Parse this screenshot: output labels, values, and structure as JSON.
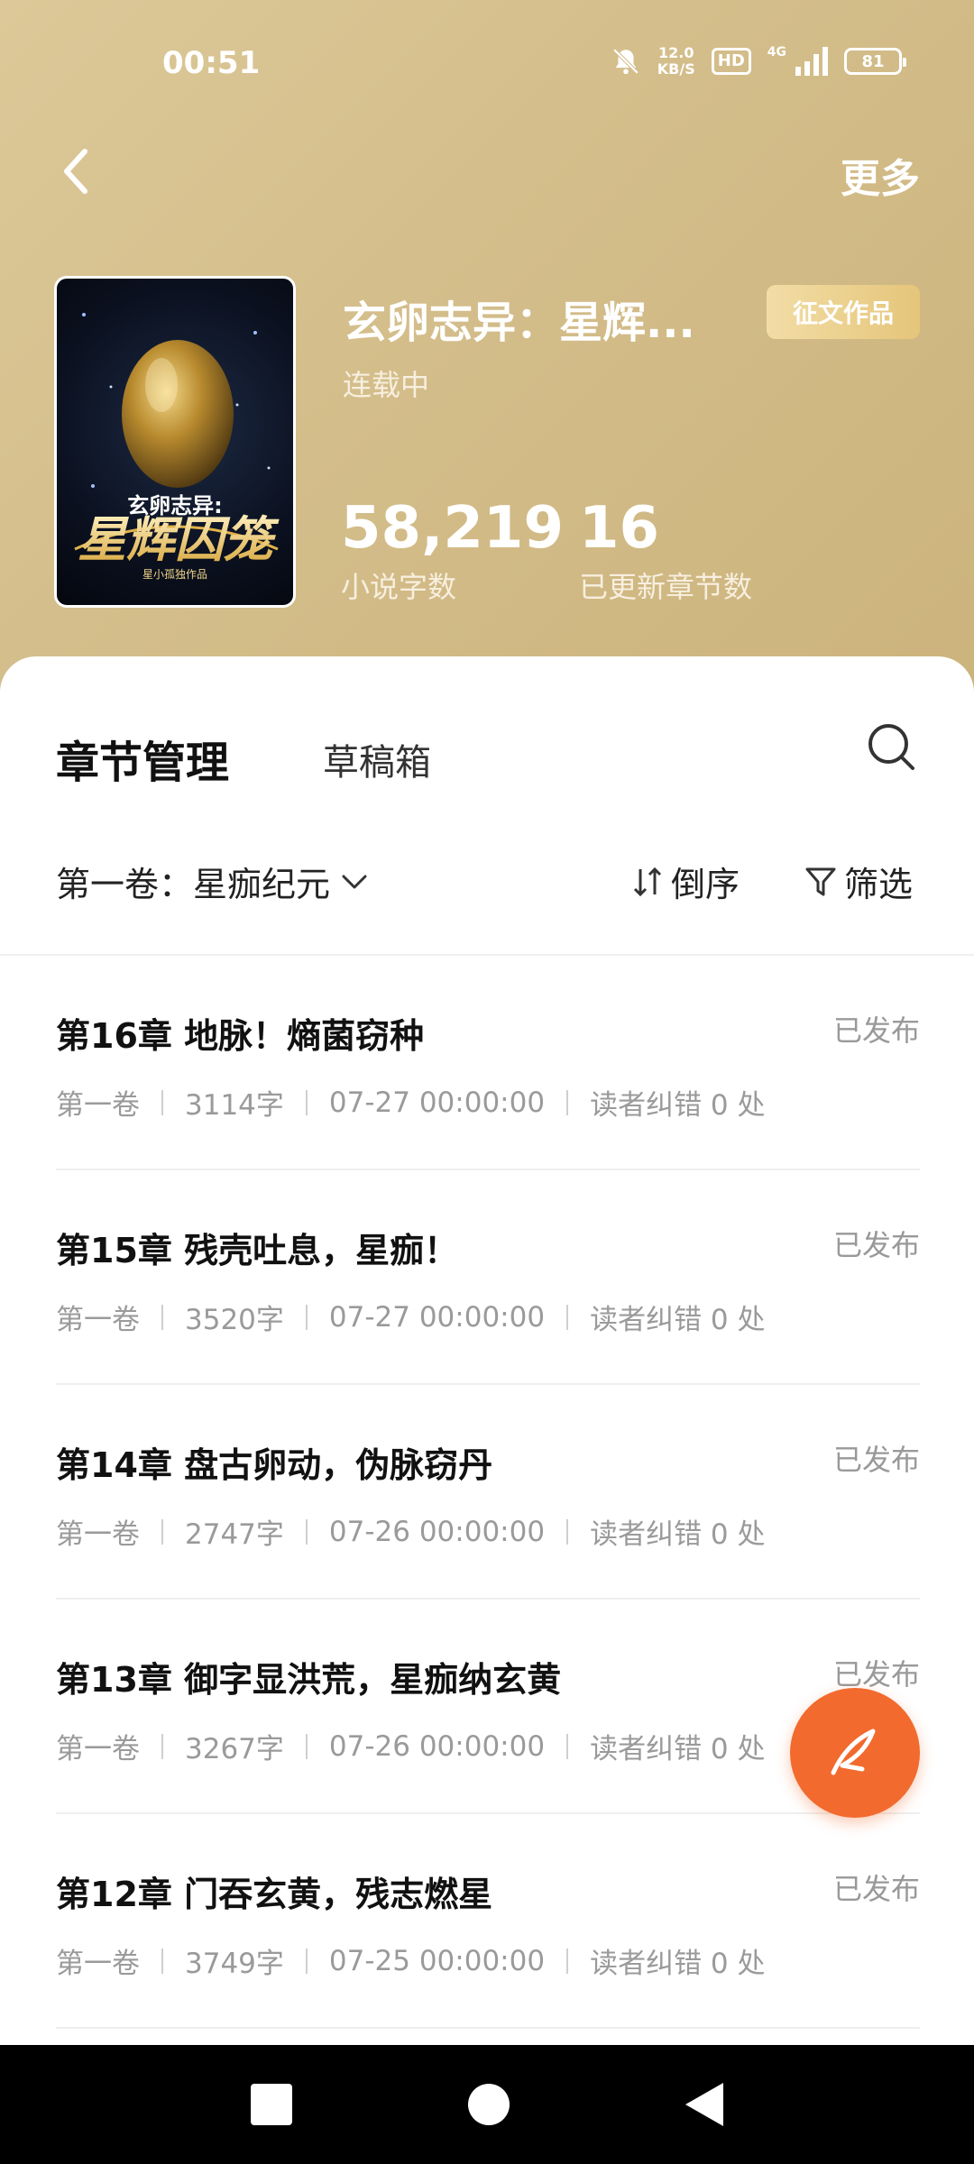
{
  "status_bar": {
    "time": "00:51",
    "net_speed_value": "12.0",
    "net_speed_unit": "KB/S",
    "hd_label": "HD",
    "net_type": "4G",
    "battery": "81"
  },
  "nav": {
    "back_icon": "chevron-left-icon",
    "more_label": "更多"
  },
  "book": {
    "title": "玄卵志异：星辉...",
    "contest_badge": "征文作品",
    "status": "连载中",
    "cover_title_small": "玄卵志异:",
    "cover_title_large": "星辉囚笼",
    "cover_subtitle": "星小孤独作品",
    "word_count": "58,219",
    "word_count_label": "小说字数",
    "chapter_count": "16",
    "chapter_count_label": "已更新章节数"
  },
  "tabs": {
    "active": "章节管理",
    "inactive": "草稿箱"
  },
  "toolbar": {
    "volume": "第一卷：星痂纪元",
    "sort_label": "倒序",
    "filter_label": "筛选"
  },
  "chapters": [
    {
      "title": "第16章 地脉！熵菌窃种",
      "status": "已发布",
      "volume": "第一卷",
      "words": "3114字",
      "time": "07-27 00:00:00",
      "errors": "读者纠错 0 处"
    },
    {
      "title": "第15章 残壳吐息，星痂！",
      "status": "已发布",
      "volume": "第一卷",
      "words": "3520字",
      "time": "07-27 00:00:00",
      "errors": "读者纠错 0 处"
    },
    {
      "title": "第14章 盘古卵动，伪脉窃丹",
      "status": "已发布",
      "volume": "第一卷",
      "words": "2747字",
      "time": "07-26 00:00:00",
      "errors": "读者纠错 0 处"
    },
    {
      "title": "第13章 御字显洪荒，星痂纳玄黄",
      "status": "已发布",
      "volume": "第一卷",
      "words": "3267字",
      "time": "07-26 00:00:00",
      "errors": "读者纠错 0 处"
    },
    {
      "title": "第12章 门吞玄黄，残志燃星",
      "status": "已发布",
      "volume": "第一卷",
      "words": "3749字",
      "time": "07-25 00:00:00",
      "errors": "读者纠错 0 处"
    }
  ],
  "colors": {
    "header_gold": "#d3bd8a",
    "fab_orange": "#f26a2e",
    "badge_gold": "#e5c57a"
  }
}
